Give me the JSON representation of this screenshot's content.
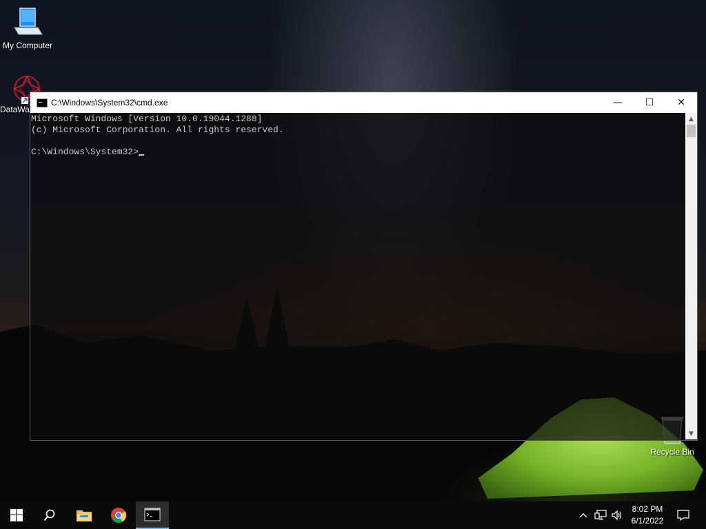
{
  "desktop": {
    "icons": [
      {
        "label": "My Computer"
      },
      {
        "label": "DataWa"
      },
      {
        "label": "Recycle Bin"
      }
    ]
  },
  "cmd_window": {
    "title": "C:\\Windows\\System32\\cmd.exe",
    "lines": [
      "Microsoft Windows [Version 10.0.19044.1288]",
      "(c) Microsoft Corporation. All rights reserved.",
      "",
      "C:\\Windows\\System32>"
    ],
    "buttons": {
      "minimize": "—",
      "maximize": "☐",
      "close": "✕"
    }
  },
  "taskbar": {
    "clock_time": "8:02 PM",
    "clock_date": "6/1/2022",
    "pinned": [
      "start",
      "search",
      "file-explorer",
      "chrome",
      "command-prompt"
    ],
    "active": "command-prompt"
  },
  "colors": {
    "console_text": "#c8c8c8",
    "taskbar": "#0a0a0a",
    "active_indicator": "#76b9ed"
  }
}
